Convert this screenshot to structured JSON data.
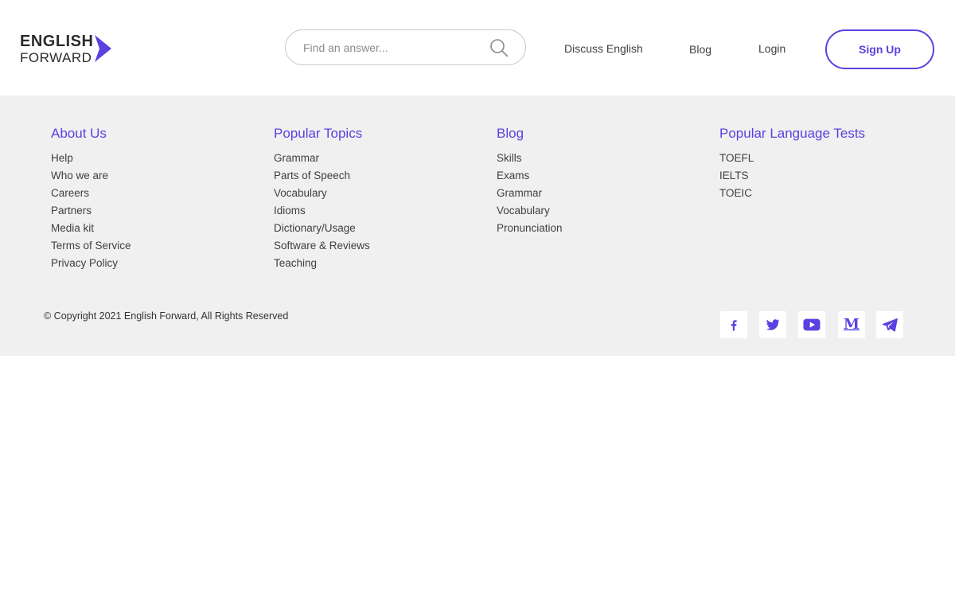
{
  "header": {
    "logo": {
      "line1": "ENGLISH",
      "line2": "FORWARD"
    },
    "search": {
      "placeholder": "Find an answer..."
    },
    "nav": {
      "discuss": "Discuss English",
      "blog": "Blog",
      "login": "Login",
      "signup": "Sign Up"
    }
  },
  "footer": {
    "columns": [
      {
        "title": "About Us",
        "items": [
          "Help",
          "Who we are",
          "Careers",
          "Partners",
          "Media kit",
          "Terms of Service",
          "Privacy Policy"
        ]
      },
      {
        "title": "Popular Topics",
        "items": [
          "Grammar",
          "Parts of Speech",
          "Vocabulary",
          "Idioms",
          "Dictionary/Usage",
          "Software & Reviews",
          "Teaching"
        ]
      },
      {
        "title": "Blog",
        "items": [
          "Skills",
          "Exams",
          "Grammar",
          "Vocabulary",
          "Pronunciation"
        ]
      },
      {
        "title": "Popular Language Tests",
        "items": [
          "TOEFL",
          "IELTS",
          "TOEIC"
        ]
      }
    ],
    "copyright": "© Copyright 2021 English Forward, All Rights Reserved",
    "social": [
      "facebook-icon",
      "twitter-icon",
      "youtube-icon",
      "medium-icon",
      "telegram-icon"
    ],
    "social_medium_letter": "M"
  },
  "colors": {
    "accent": "#5b41e0",
    "footer_bg": "#f0f0f0",
    "text": "#3f3f3f"
  }
}
